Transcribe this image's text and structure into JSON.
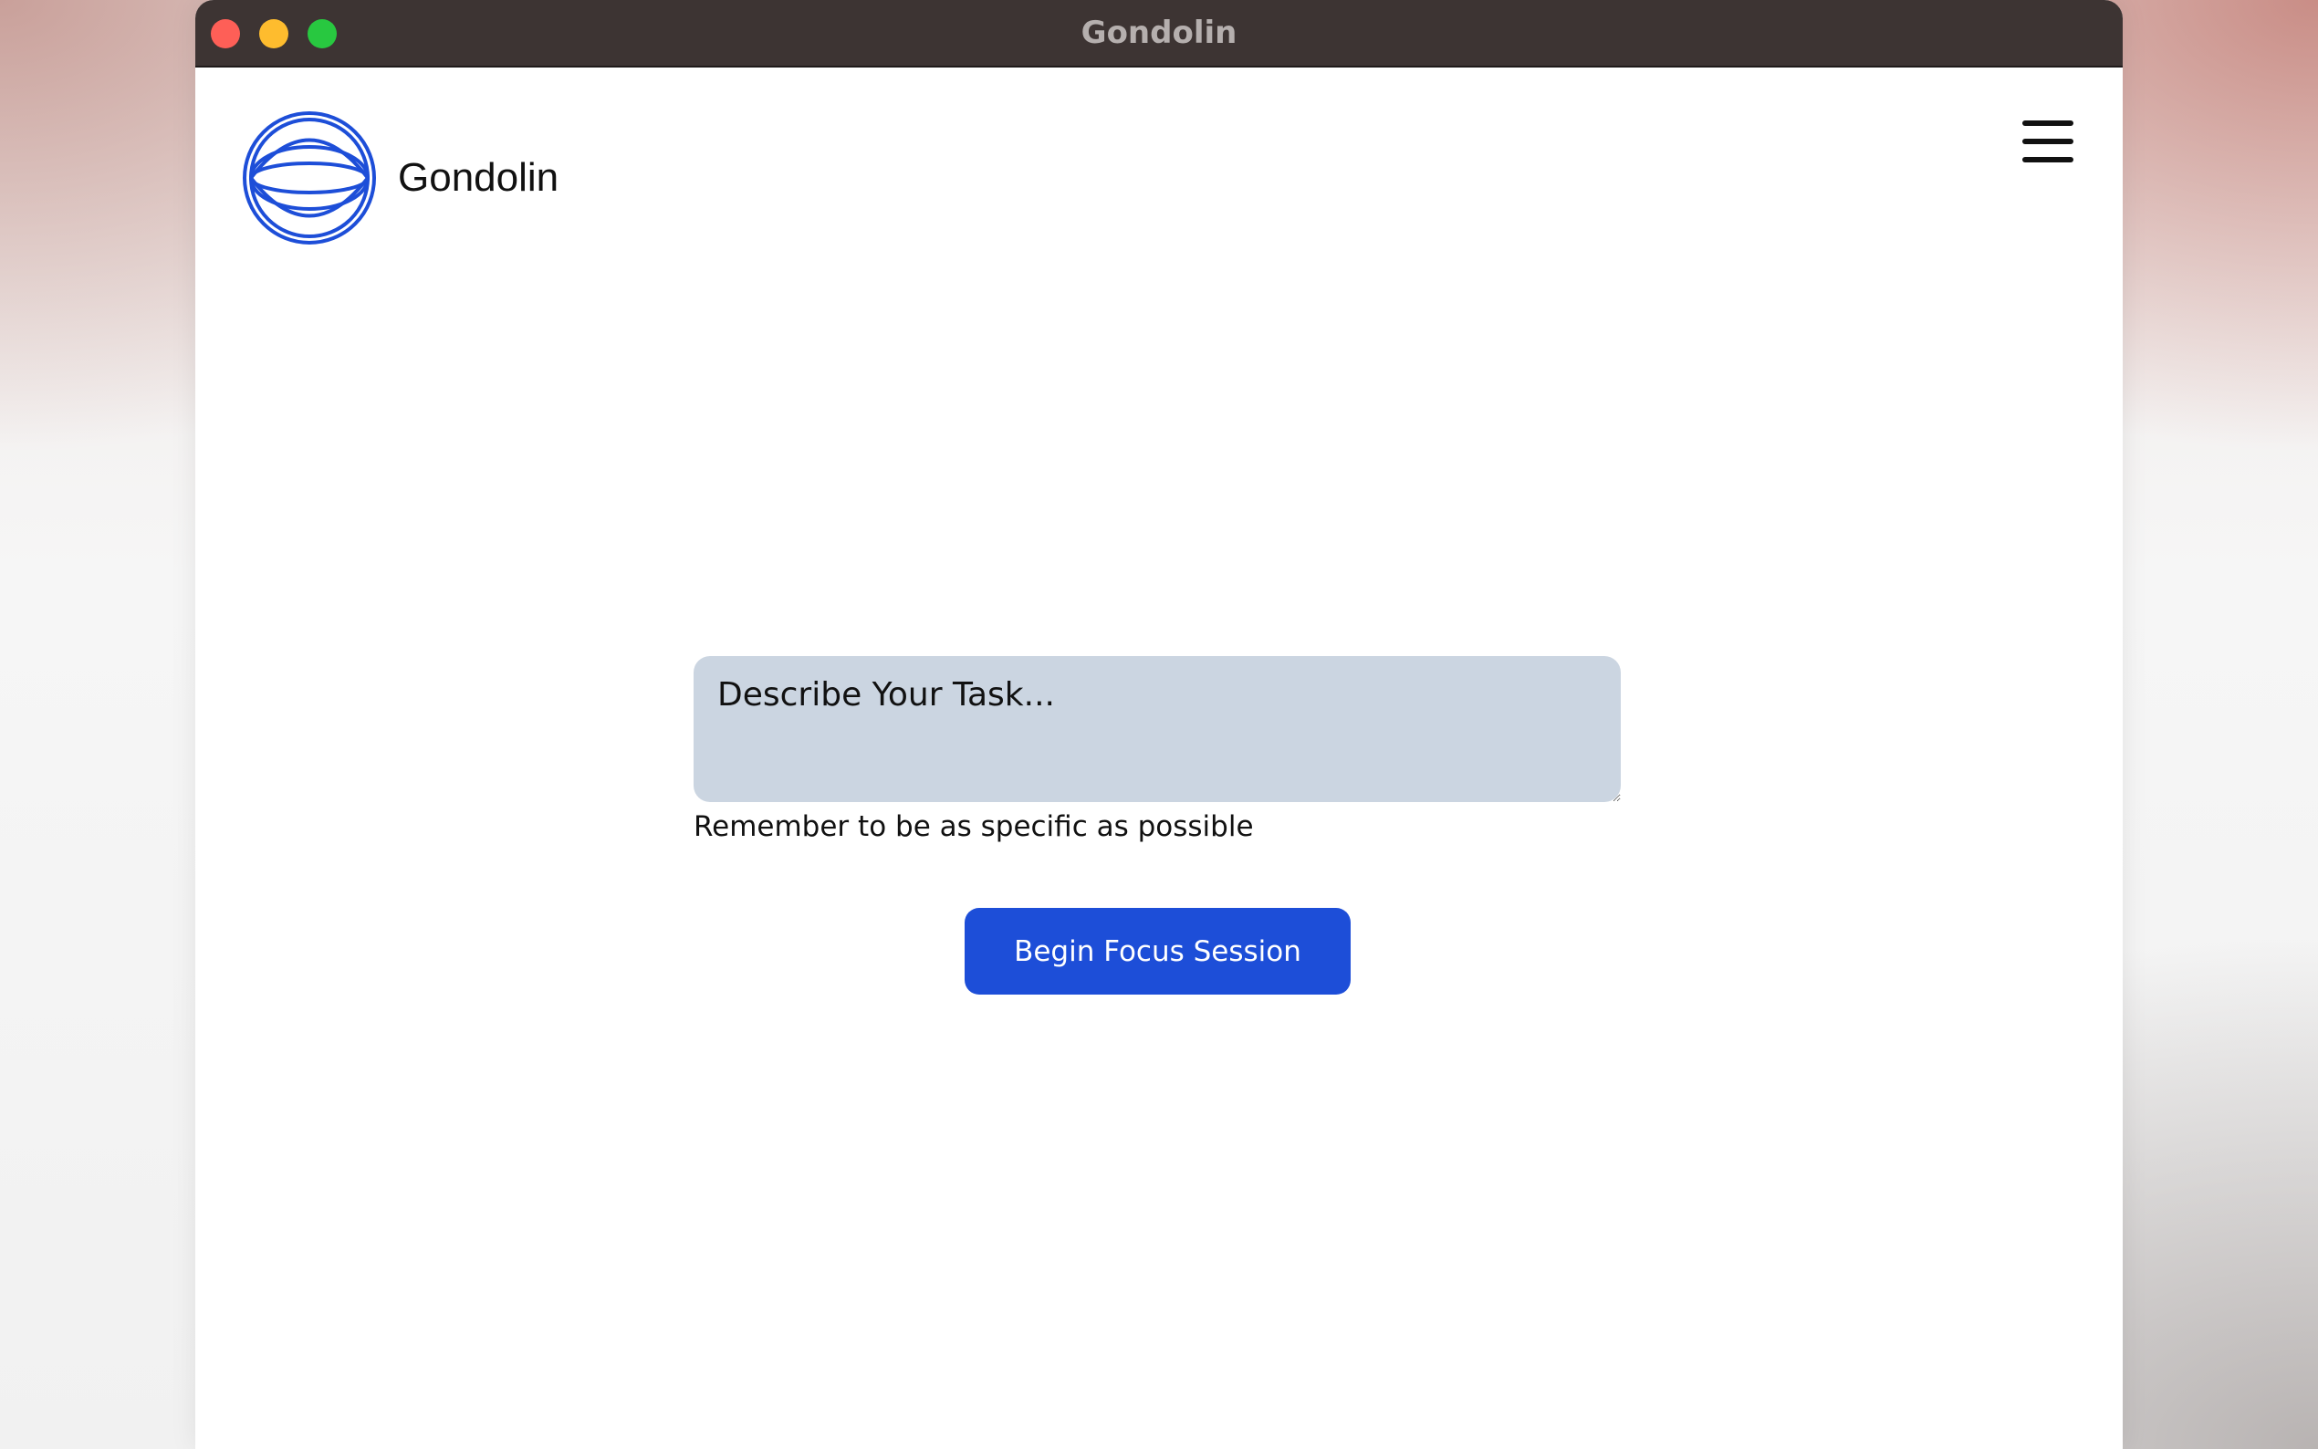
{
  "window": {
    "title": "Gondolin"
  },
  "header": {
    "brand_name": "Gondolin",
    "logo_icon": "interlaced-circle-logo-icon",
    "menu_icon": "hamburger-menu-icon"
  },
  "main": {
    "task_input": {
      "placeholder": "Describe Your Task...",
      "value": ""
    },
    "helper_text": "Remember to be as specific as possible",
    "begin_button_label": "Begin Focus Session"
  },
  "colors": {
    "accent": "#1d4ed8",
    "input_background": "#cbd5e1",
    "titlebar": "#3d3433",
    "close": "#fe5f57",
    "minimize": "#febc2e",
    "zoom": "#28c840"
  }
}
